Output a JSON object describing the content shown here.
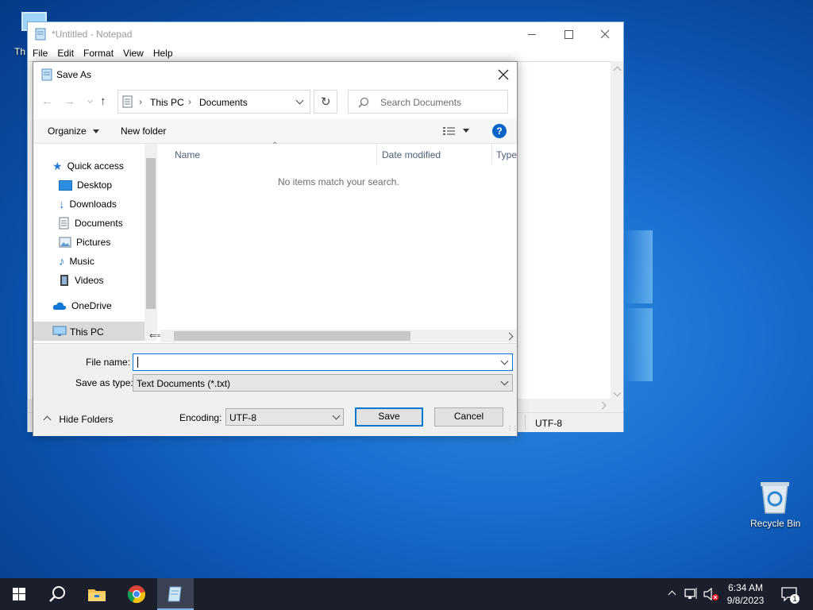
{
  "desktop": {
    "icons": [
      {
        "label": "Th",
        "name": "this-pc"
      },
      {
        "label": "Recycle Bin",
        "name": "recycle-bin"
      }
    ]
  },
  "notepad": {
    "title": "*Untitled - Notepad",
    "menu": [
      "File",
      "Edit",
      "Format",
      "View",
      "Help"
    ],
    "status_encoding": "UTF-8"
  },
  "dialog": {
    "title": "Save As",
    "breadcrumb": [
      "This PC",
      "Documents"
    ],
    "search_placeholder": "Search Documents",
    "toolbar": {
      "organize": "Organize",
      "new_folder": "New folder"
    },
    "nav": {
      "quick_access": "Quick access",
      "items": [
        {
          "label": "Desktop",
          "pinned": true
        },
        {
          "label": "Downloads",
          "pinned": true
        },
        {
          "label": "Documents",
          "pinned": true
        },
        {
          "label": "Pictures",
          "pinned": true
        },
        {
          "label": "Music",
          "pinned": false
        },
        {
          "label": "Videos",
          "pinned": false
        }
      ],
      "onedrive": "OneDrive",
      "this_pc": "This PC"
    },
    "columns": [
      "Name",
      "Date modified",
      "Type"
    ],
    "empty_message": "No items match your search.",
    "file_name_label": "File name:",
    "file_name_value": "",
    "save_as_type_label": "Save as type:",
    "save_as_type_value": "Text Documents (*.txt)",
    "hide_folders": "Hide Folders",
    "encoding_label": "Encoding:",
    "encoding_value": "UTF-8",
    "save": "Save",
    "cancel": "Cancel"
  },
  "taskbar": {
    "time": "6:34 AM",
    "date": "9/8/2023",
    "notification_count": "1"
  },
  "colors": {
    "accent": "#0078d7",
    "desktop": "#0a4ea8",
    "taskbar": "#1a1f2b"
  }
}
